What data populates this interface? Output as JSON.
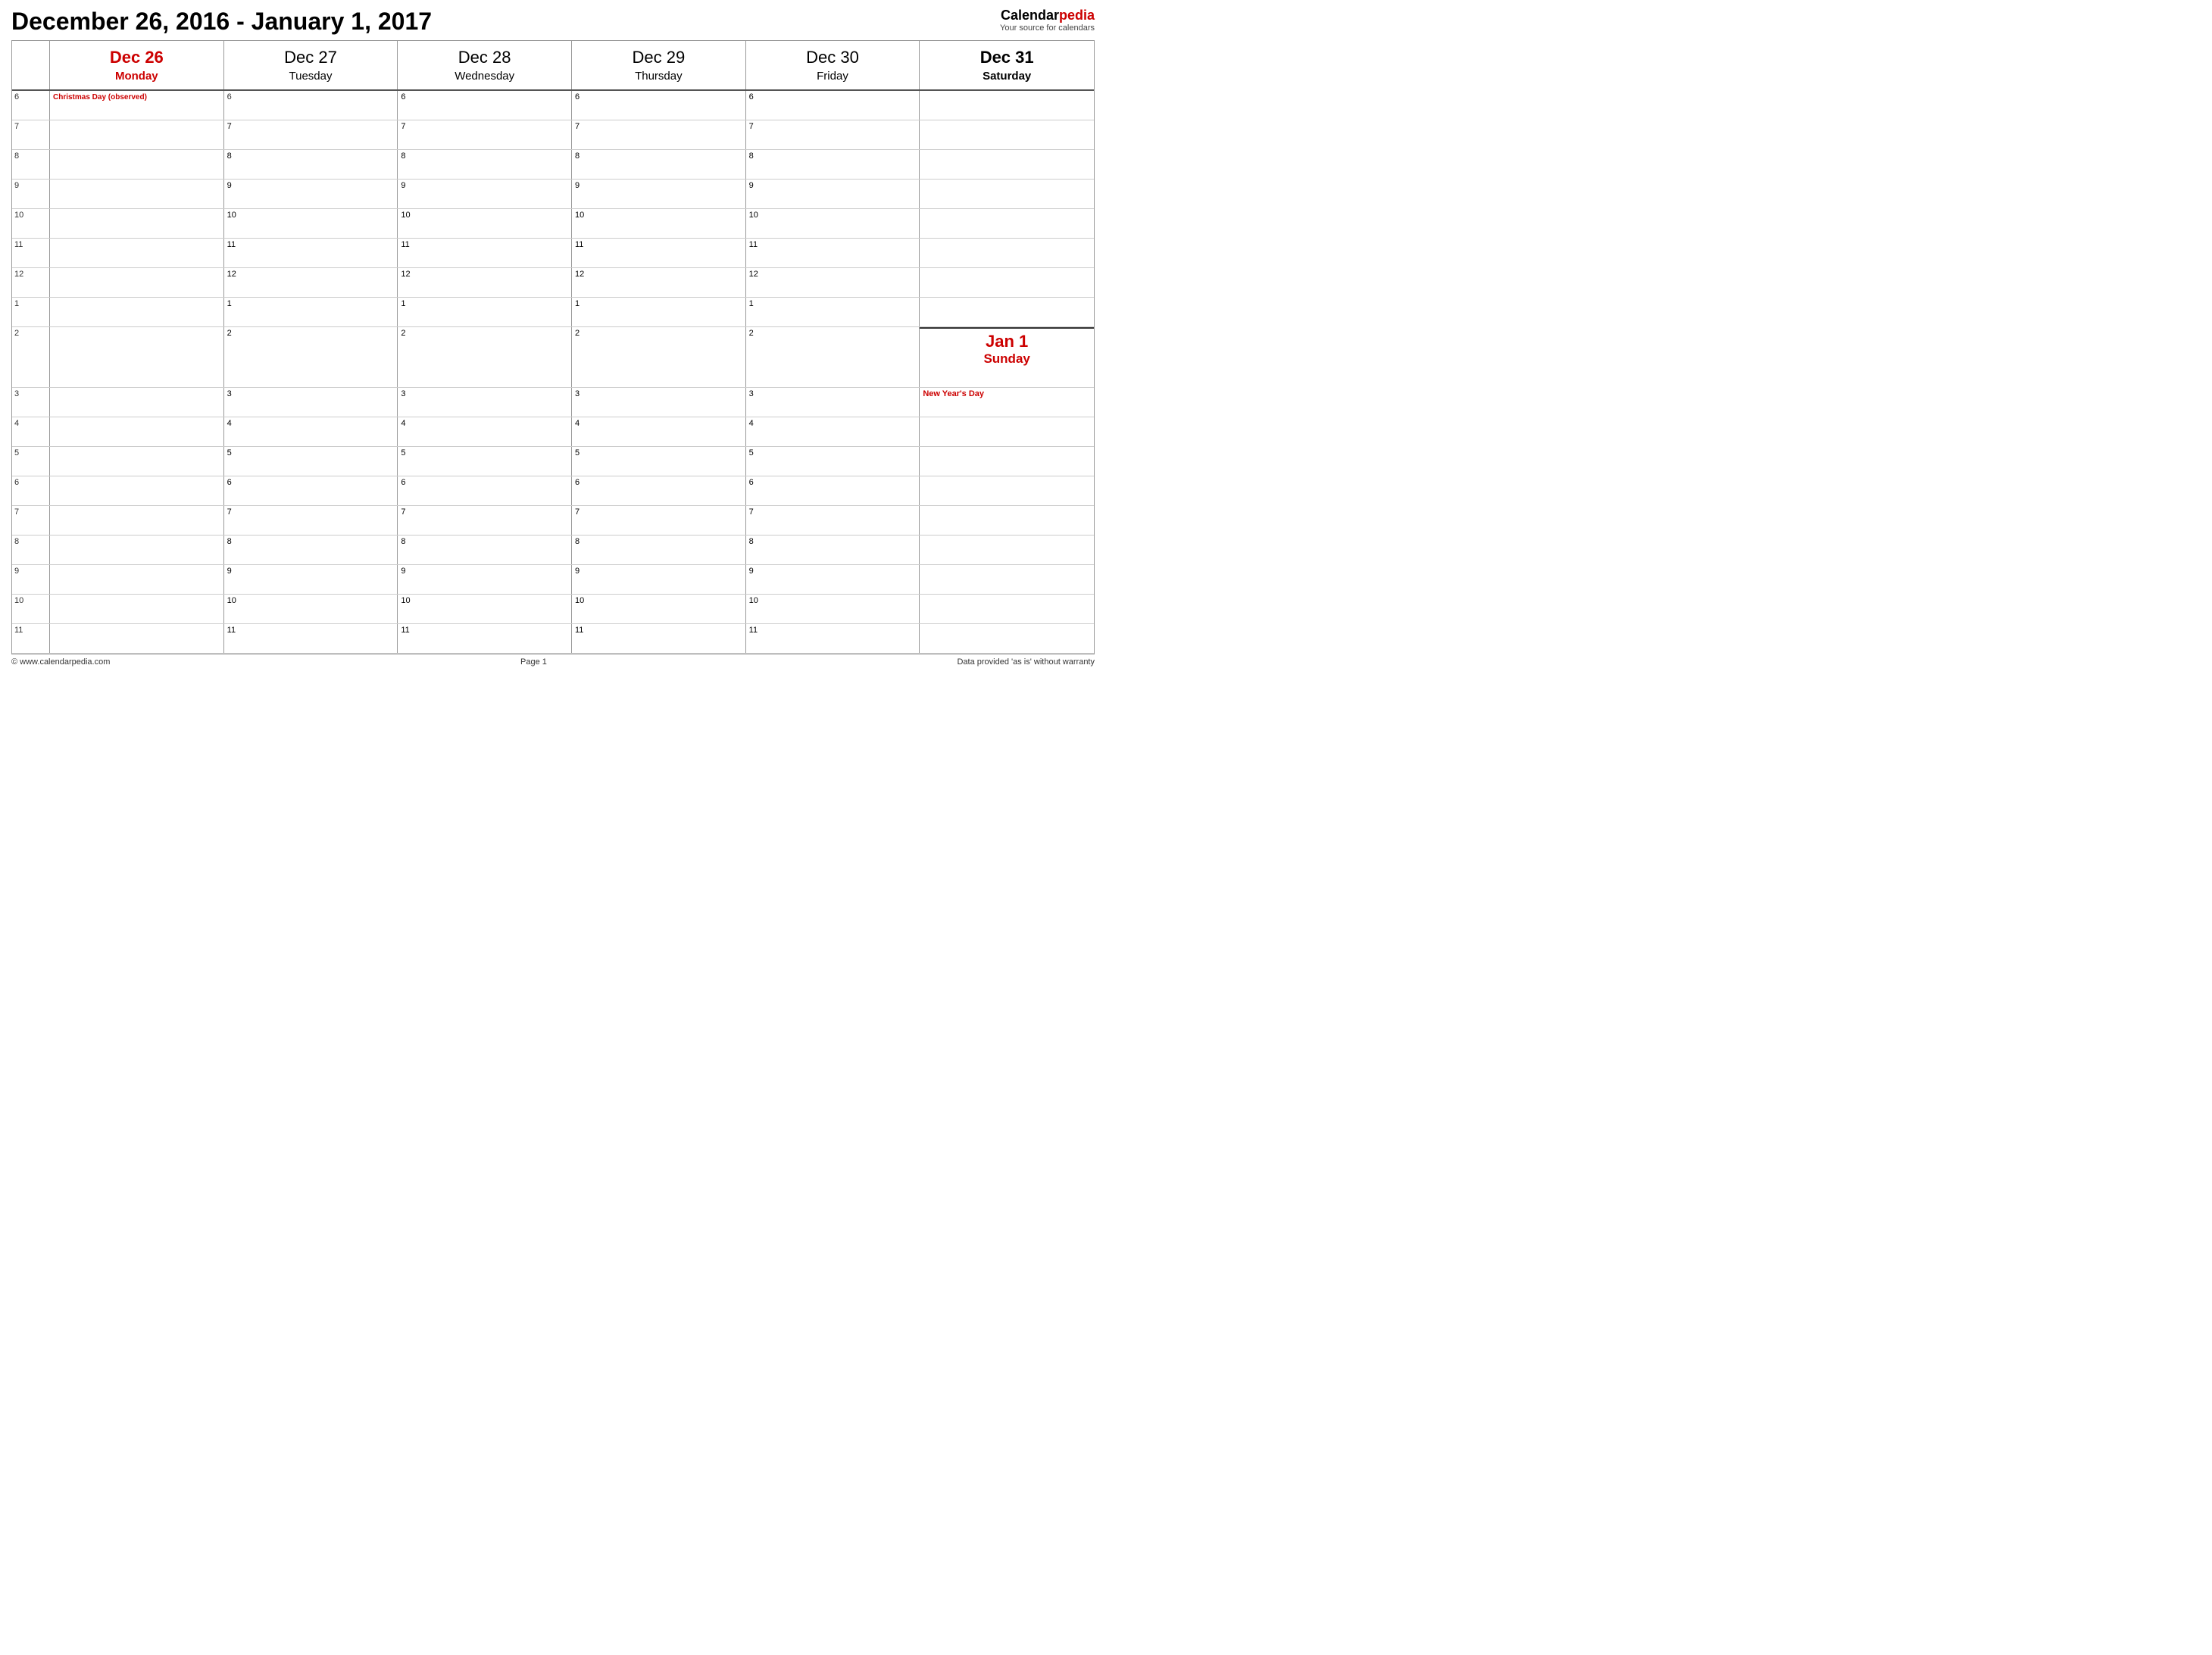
{
  "header": {
    "title": "December 26, 2016 - January 1, 2017",
    "brand_calendar": "Calendar",
    "brand_pedia": "pedia",
    "brand_tagline": "Your source for calendars"
  },
  "days": [
    {
      "id": "dec26",
      "date": "Dec 26",
      "weekday": "Monday",
      "style": "red-bold",
      "holiday": "Christmas Day (observed)"
    },
    {
      "id": "dec27",
      "date": "Dec 27",
      "weekday": "Tuesday",
      "style": "normal"
    },
    {
      "id": "dec28",
      "date": "Dec 28",
      "weekday": "Wednesday",
      "style": "normal"
    },
    {
      "id": "dec29",
      "date": "Dec 29",
      "weekday": "Thursday",
      "style": "normal"
    },
    {
      "id": "dec30",
      "date": "Dec 30",
      "weekday": "Friday",
      "style": "normal"
    },
    {
      "id": "dec31-jan1",
      "date_top": "Dec 31",
      "weekday_top": "Saturday",
      "date_bottom": "Jan 1",
      "weekday_bottom": "Sunday",
      "style": "split",
      "holiday": "New Year's Day"
    }
  ],
  "hours": [
    6,
    7,
    8,
    9,
    10,
    11,
    12,
    1,
    2,
    3,
    4,
    5,
    6,
    7,
    8,
    9,
    10,
    11
  ],
  "footer": {
    "left": "© www.calendarpedia.com",
    "center": "Page 1",
    "right": "Data provided 'as is' without warranty"
  }
}
